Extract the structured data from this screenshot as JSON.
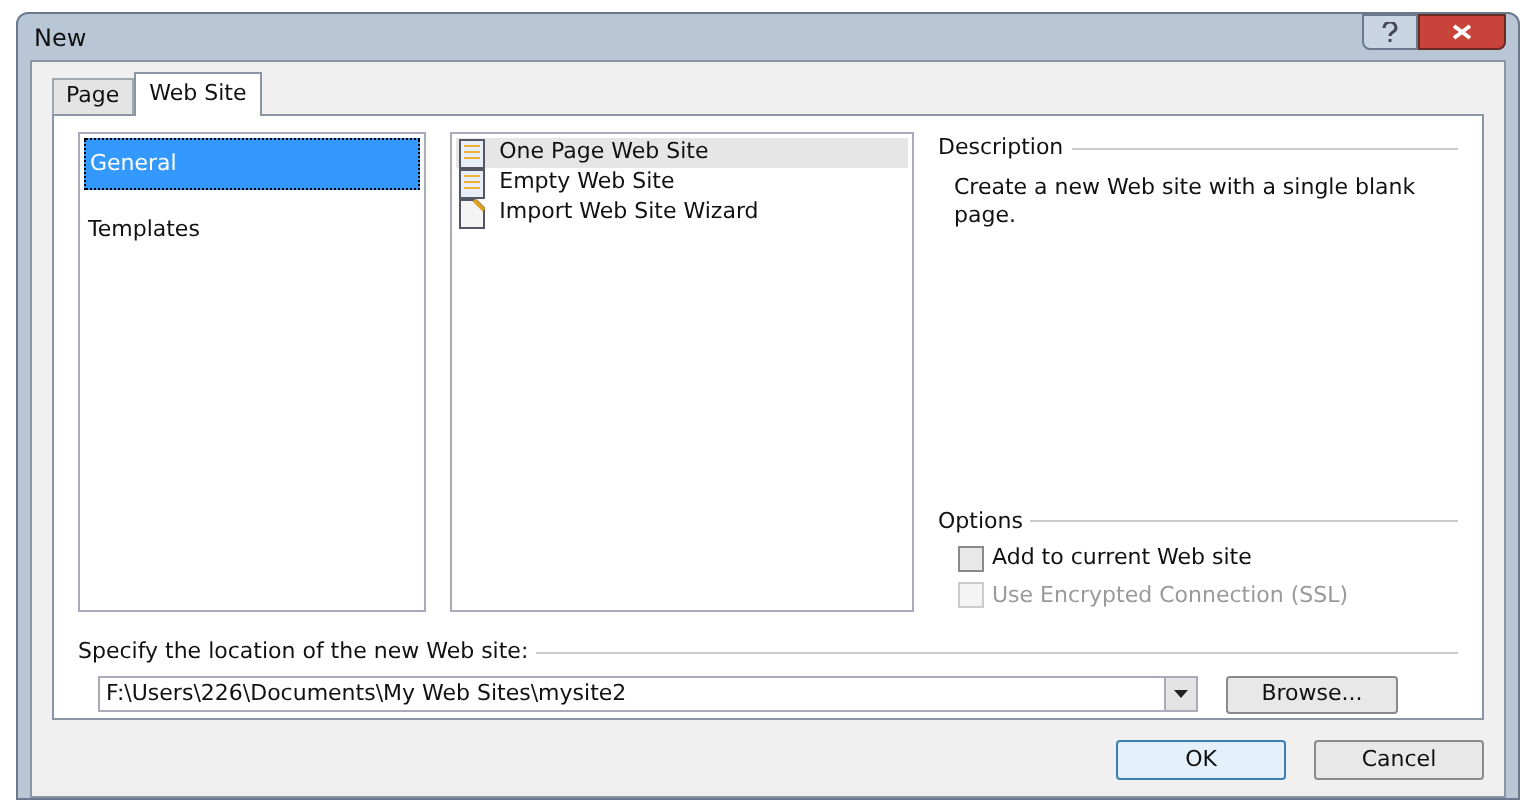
{
  "window": {
    "title": "New"
  },
  "tabs": [
    {
      "label": "Page",
      "selected": false
    },
    {
      "label": "Web Site",
      "selected": true
    }
  ],
  "categories": [
    {
      "label": "General",
      "selected": true
    },
    {
      "label": "Templates",
      "selected": false
    }
  ],
  "templates": [
    {
      "label": "One Page Web Site",
      "selected": true,
      "kind": "page"
    },
    {
      "label": "Empty Web Site",
      "selected": false,
      "kind": "page"
    },
    {
      "label": "Import Web Site Wizard",
      "selected": false,
      "kind": "wizard"
    }
  ],
  "description": {
    "heading": "Description",
    "text": "Create a new Web site with a single blank page."
  },
  "options": {
    "heading": "Options",
    "items": [
      {
        "label": "Add to current Web site",
        "checked": false,
        "disabled": false
      },
      {
        "label": "Use Encrypted Connection (SSL)",
        "checked": false,
        "disabled": true
      }
    ]
  },
  "location": {
    "label": "Specify the location of the new Web site:",
    "value": "F:\\Users\\226\\Documents\\My Web Sites\\mysite2",
    "browse": "Browse..."
  },
  "buttons": [
    {
      "label": "OK",
      "default": true
    },
    {
      "label": "Cancel",
      "default": false
    }
  ]
}
